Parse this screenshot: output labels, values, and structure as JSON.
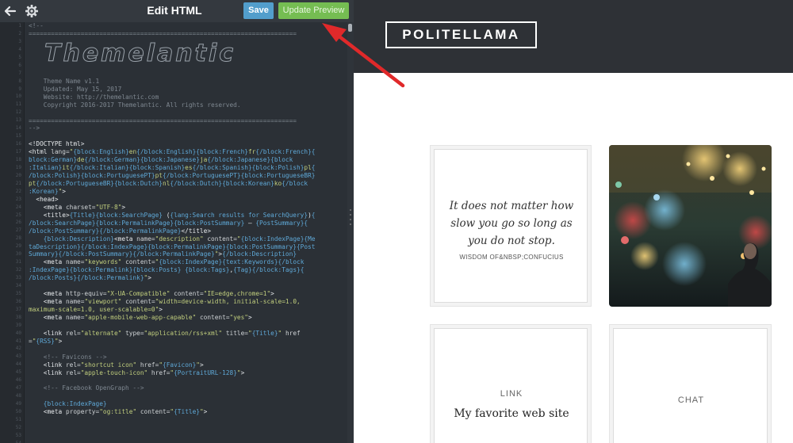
{
  "toolbar": {
    "back_icon": "arrow-left-icon",
    "settings_icon": "gear-icon",
    "title": "Edit HTML",
    "save_label": "Save",
    "update_preview_label": "Update Preview"
  },
  "colors": {
    "editor_bg": "#2b3036",
    "save_button": "#529ecc",
    "update_button": "#75bd52",
    "annotation_arrow": "#e0292a",
    "preview_header": "#2e3136"
  },
  "code_lines": [
    [
      [
        "cmt",
        "<!--"
      ]
    ],
    [
      [
        "cmt",
        "========================================================================"
      ]
    ],
    [
      [
        "ascii",
        "Themelantic"
      ]
    ],
    [
      [
        "cmt",
        ""
      ]
    ],
    [
      [
        "cmt",
        "    Theme Name v1.1"
      ]
    ],
    [
      [
        "cmt",
        "    Updated: May 15, 2017"
      ]
    ],
    [
      [
        "cmt",
        "    Website: http://themelantic.com"
      ]
    ],
    [
      [
        "cmt",
        "    Copyright 2016-2017 Themelantic. All rights reserved."
      ]
    ],
    [
      [
        "cmt",
        ""
      ]
    ],
    [
      [
        "cmt",
        "========================================================================"
      ]
    ],
    [
      [
        "cmt",
        "-->"
      ]
    ],
    [
      [
        "tag",
        ""
      ]
    ],
    [
      [
        "tag",
        "<!DOCTYPE html>"
      ]
    ],
    [
      [
        "tag",
        "<html "
      ],
      [
        "attr",
        "lang="
      ],
      [
        "str",
        "\""
      ],
      [
        "blk",
        "{block:English}"
      ],
      [
        "str",
        "en"
      ],
      [
        "blk",
        "{/block:English}{block:French}"
      ],
      [
        "str",
        "fr"
      ],
      [
        "blk",
        "{/block:French}{"
      ]
    ],
    [
      [
        "blk",
        "block:German}"
      ],
      [
        "str",
        "de"
      ],
      [
        "blk",
        "{/block:German}{block:Japanese}"
      ],
      [
        "str",
        "ja"
      ],
      [
        "blk",
        "{/block:Japanese}{block"
      ]
    ],
    [
      [
        "blk",
        ":Italian}"
      ],
      [
        "str",
        "it"
      ],
      [
        "blk",
        "{/block:Italian}{block:Spanish}"
      ],
      [
        "str",
        "es"
      ],
      [
        "blk",
        "{/block:Spanish}{block:Polish}"
      ],
      [
        "str",
        "pl"
      ],
      [
        "blk",
        "{"
      ]
    ],
    [
      [
        "blk",
        "/block:Polish}{block:PortuguesePT}"
      ],
      [
        "str",
        "pt"
      ],
      [
        "blk",
        "{/block:PortuguesePT}{block:PortugueseBR}"
      ]
    ],
    [
      [
        "str",
        "pt"
      ],
      [
        "blk",
        "{/block:PortugueseBR}{block:Dutch}"
      ],
      [
        "str",
        "nl"
      ],
      [
        "blk",
        "{/block:Dutch}{block:Korean}"
      ],
      [
        "str",
        "ko"
      ],
      [
        "blk",
        "{/block"
      ]
    ],
    [
      [
        "blk",
        ":Korean}"
      ],
      [
        "str",
        "\""
      ],
      [
        "tag",
        ">"
      ]
    ],
    [
      [
        "tag",
        "  <head>"
      ]
    ],
    [
      [
        "tag",
        "    <meta "
      ],
      [
        "attr",
        "charset="
      ],
      [
        "str",
        "\"UTF-8\""
      ],
      [
        "tag",
        ">"
      ]
    ],
    [
      [
        "tag",
        "    <title>"
      ],
      [
        "blk",
        "{Title}{block:SearchPage}"
      ],
      [
        "tag",
        " ("
      ],
      [
        "blk",
        "{lang:Search results for SearchQuery}"
      ],
      [
        "tag",
        ")"
      ],
      [
        "blk",
        "{"
      ]
    ],
    [
      [
        "blk",
        "/block:SearchPage}{block:PermalinkPage}{block:PostSummary}"
      ],
      [
        "tag",
        " — "
      ],
      [
        "blk",
        "{PostSummary}{"
      ]
    ],
    [
      [
        "blk",
        "/block:PostSummary}{/block:PermalinkPage}"
      ],
      [
        "tag",
        "</title>"
      ]
    ],
    [
      [
        "tag",
        "    "
      ],
      [
        "blk",
        "{block:Description}"
      ],
      [
        "tag",
        "<meta "
      ],
      [
        "attr",
        "name="
      ],
      [
        "str",
        "\"description\""
      ],
      [
        "attr",
        " content="
      ],
      [
        "str",
        "\""
      ],
      [
        "blk",
        "{block:IndexPage}{Me"
      ]
    ],
    [
      [
        "blk",
        "taDescription}{/block:IndexPage}{block:PermalinkPage}{block:PostSummary}{Post"
      ]
    ],
    [
      [
        "blk",
        "Summary}{/block:PostSummary}{/block:PermalinkPage}"
      ],
      [
        "str",
        "\""
      ],
      [
        "tag",
        ">"
      ],
      [
        "blk",
        "{/block:Description}"
      ]
    ],
    [
      [
        "tag",
        "    <meta "
      ],
      [
        "attr",
        "name="
      ],
      [
        "str",
        "\"keywords\""
      ],
      [
        "attr",
        " content="
      ],
      [
        "str",
        "\""
      ],
      [
        "blk",
        "{block:IndexPage}{text:Keywords}{/block"
      ]
    ],
    [
      [
        "blk",
        ":IndexPage}{block:Permalink}{block:Posts}"
      ],
      [
        "tag",
        " "
      ],
      [
        "blk",
        "{block:Tags}"
      ],
      [
        "tag",
        ","
      ],
      [
        "blk",
        "{Tag}{/block:Tags}{"
      ]
    ],
    [
      [
        "blk",
        "/block:Posts}{/block:Permalink}"
      ],
      [
        "str",
        "\""
      ],
      [
        "tag",
        ">"
      ]
    ],
    [
      [
        "tag",
        ""
      ]
    ],
    [
      [
        "tag",
        "    <meta "
      ],
      [
        "attr",
        "http-equiv="
      ],
      [
        "str",
        "\"X-UA-Compatible\""
      ],
      [
        "attr",
        " content="
      ],
      [
        "str",
        "\"IE=edge,chrome=1\""
      ],
      [
        "tag",
        ">"
      ]
    ],
    [
      [
        "tag",
        "    <meta "
      ],
      [
        "attr",
        "name="
      ],
      [
        "str",
        "\"viewport\""
      ],
      [
        "attr",
        " content="
      ],
      [
        "str",
        "\"width=device-width, initial-scale=1.0,"
      ]
    ],
    [
      [
        "str",
        "maximum-scale=1.0, user-scalable=0\""
      ],
      [
        "tag",
        ">"
      ]
    ],
    [
      [
        "tag",
        "    <meta "
      ],
      [
        "attr",
        "name="
      ],
      [
        "str",
        "\"apple-mobile-web-app-capable\""
      ],
      [
        "attr",
        " content="
      ],
      [
        "str",
        "\"yes\""
      ],
      [
        "tag",
        ">"
      ]
    ],
    [
      [
        "tag",
        ""
      ]
    ],
    [
      [
        "tag",
        "    <link "
      ],
      [
        "attr",
        "rel="
      ],
      [
        "str",
        "\"alternate\""
      ],
      [
        "attr",
        " type="
      ],
      [
        "str",
        "\"application/rss+xml\""
      ],
      [
        "attr",
        " title="
      ],
      [
        "str",
        "\""
      ],
      [
        "blk",
        "{Title}"
      ],
      [
        "str",
        "\""
      ],
      [
        "attr",
        " href"
      ]
    ],
    [
      [
        "attr",
        "="
      ],
      [
        "str",
        "\""
      ],
      [
        "blk",
        "{RSS}"
      ],
      [
        "str",
        "\""
      ],
      [
        "tag",
        ">"
      ]
    ],
    [
      [
        "tag",
        ""
      ]
    ],
    [
      [
        "cmt",
        "    <!-- Favicons -->"
      ]
    ],
    [
      [
        "tag",
        "    <link "
      ],
      [
        "attr",
        "rel="
      ],
      [
        "str",
        "\"shortcut icon\""
      ],
      [
        "attr",
        " href="
      ],
      [
        "str",
        "\""
      ],
      [
        "blk",
        "{Favicon}"
      ],
      [
        "str",
        "\""
      ],
      [
        "tag",
        ">"
      ]
    ],
    [
      [
        "tag",
        "    <link "
      ],
      [
        "attr",
        "rel="
      ],
      [
        "str",
        "\"apple-touch-icon\""
      ],
      [
        "attr",
        " href="
      ],
      [
        "str",
        "\""
      ],
      [
        "blk",
        "{PortraitURL-128}"
      ],
      [
        "str",
        "\""
      ],
      [
        "tag",
        ">"
      ]
    ],
    [
      [
        "tag",
        ""
      ]
    ],
    [
      [
        "cmt",
        "    <!-- Facebook OpenGraph -->"
      ]
    ],
    [
      [
        "tag",
        ""
      ]
    ],
    [
      [
        "tag",
        "    "
      ],
      [
        "blk",
        "{block:IndexPage}"
      ]
    ],
    [
      [
        "tag",
        "    <meta "
      ],
      [
        "attr",
        "property="
      ],
      [
        "str",
        "\"og:title\""
      ],
      [
        "attr",
        " content="
      ],
      [
        "str",
        "\""
      ],
      [
        "blk",
        "{Title}"
      ],
      [
        "str",
        "\""
      ],
      [
        "tag",
        ">"
      ]
    ]
  ],
  "preview": {
    "blog_title": "POLITELLAMA",
    "quote_post": {
      "text": "It does not matter how slow you go so long as you do not stop.",
      "source": "WISDOM OF&NBSP;CONFUCIUS"
    },
    "link_post": {
      "type_label": "LINK",
      "title": "My favorite web site"
    },
    "chat_post": {
      "type_label": "CHAT"
    }
  }
}
